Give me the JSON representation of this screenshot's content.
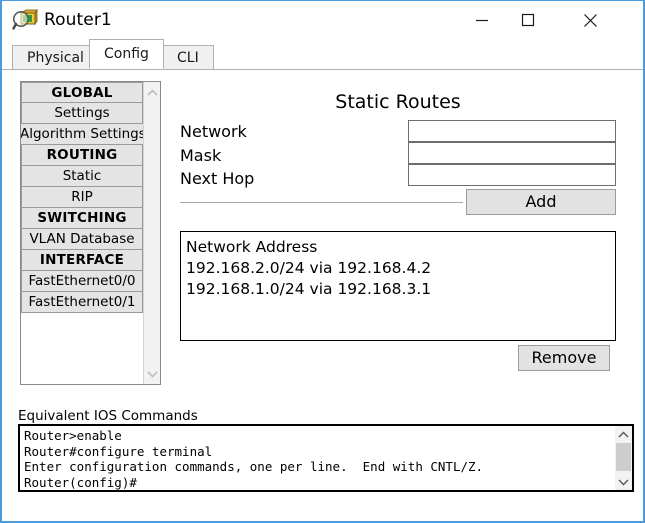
{
  "window": {
    "title": "Router1",
    "icon": "inspect-router-icon",
    "accent_color": "#4a9ae0",
    "controls": {
      "minimize": "—",
      "maximize": "□",
      "close": "✕"
    }
  },
  "tabs": [
    {
      "label": "Physical",
      "active": false
    },
    {
      "label": "Config",
      "active": true
    },
    {
      "label": "CLI",
      "active": false
    }
  ],
  "sidebar": {
    "items": [
      {
        "label": "GLOBAL",
        "type": "section"
      },
      {
        "label": "Settings",
        "type": "item"
      },
      {
        "label": "Algorithm Settings",
        "type": "item"
      },
      {
        "label": "ROUTING",
        "type": "section"
      },
      {
        "label": "Static",
        "type": "item"
      },
      {
        "label": "RIP",
        "type": "item"
      },
      {
        "label": "SWITCHING",
        "type": "section"
      },
      {
        "label": "VLAN Database",
        "type": "item"
      },
      {
        "label": "INTERFACE",
        "type": "section"
      },
      {
        "label": "FastEthernet0/0",
        "type": "item"
      },
      {
        "label": "FastEthernet0/1",
        "type": "item"
      }
    ],
    "scroll_up": "∧",
    "scroll_down": "∨"
  },
  "static_routes": {
    "title": "Static Routes",
    "fields": [
      {
        "label": "Network",
        "value": "",
        "placeholder": ""
      },
      {
        "label": "Mask",
        "value": "",
        "placeholder": ""
      },
      {
        "label": "Next Hop",
        "value": "",
        "placeholder": ""
      }
    ],
    "add_label": "Add",
    "remove_label": "Remove",
    "list_header": "Network Address",
    "routes": [
      "192.168.2.0/24 via 192.168.4.2",
      "192.168.1.0/24 via 192.168.3.1"
    ]
  },
  "ios": {
    "label": "Equivalent IOS Commands",
    "lines": [
      "Router>enable",
      "Router#configure terminal",
      "Enter configuration commands, one per line.  End with CNTL/Z.",
      "Router(config)#"
    ],
    "scroll_up": "∧",
    "scroll_down": "∨"
  }
}
